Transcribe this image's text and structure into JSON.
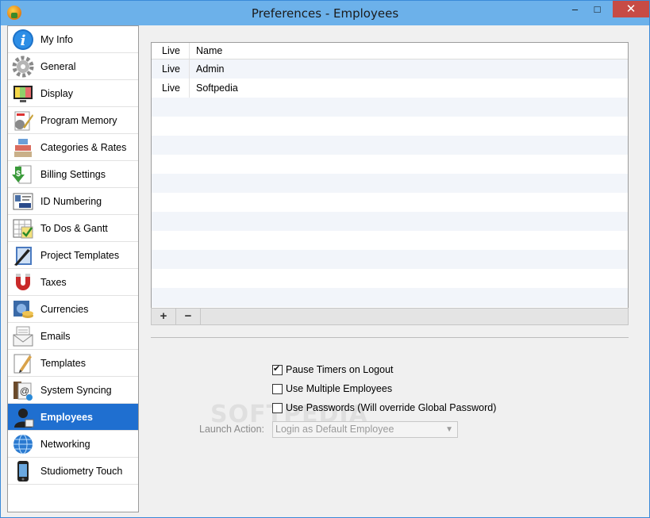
{
  "window": {
    "title": "Preferences - Employees"
  },
  "window_controls": {
    "minimize": "–",
    "maximize": "□",
    "close": "✕"
  },
  "sidebar": {
    "items": [
      {
        "label": "My Info",
        "icon": "info-icon"
      },
      {
        "label": "General",
        "icon": "gear-icon"
      },
      {
        "label": "Display",
        "icon": "monitor-icon"
      },
      {
        "label": "Program Memory",
        "icon": "memory-icon"
      },
      {
        "label": "Categories & Rates",
        "icon": "categories-icon"
      },
      {
        "label": "Billing Settings",
        "icon": "billing-icon"
      },
      {
        "label": "ID Numbering",
        "icon": "id-card-icon"
      },
      {
        "label": "To Dos & Gantt",
        "icon": "todo-icon"
      },
      {
        "label": "Project Templates",
        "icon": "project-templates-icon"
      },
      {
        "label": "Taxes",
        "icon": "magnet-icon"
      },
      {
        "label": "Currencies",
        "icon": "currency-icon"
      },
      {
        "label": "Emails",
        "icon": "envelope-icon"
      },
      {
        "label": "Templates",
        "icon": "template-icon"
      },
      {
        "label": "System Syncing",
        "icon": "sync-icon"
      },
      {
        "label": "Employees",
        "icon": "employee-icon"
      },
      {
        "label": "Networking",
        "icon": "globe-icon"
      },
      {
        "label": "Studiometry Touch",
        "icon": "phone-icon"
      }
    ],
    "selected_index": 14
  },
  "employees_table": {
    "columns": [
      "Live",
      "Name"
    ],
    "rows": [
      {
        "live": "Live",
        "name": "Admin"
      },
      {
        "live": "Live",
        "name": "Softpedia"
      }
    ],
    "add_label": "+",
    "remove_label": "−"
  },
  "options": {
    "pause_timers": {
      "label": "Pause Timers on Logout",
      "checked": true
    },
    "multiple_employees": {
      "label": "Use Multiple Employees",
      "checked": false
    },
    "use_passwords": {
      "label": "Use Passwords (Will override Global Password)",
      "checked": false
    }
  },
  "launch_action": {
    "label": "Launch Action:",
    "value": "Login as Default Employee"
  },
  "watermark": "SOFTPEDIA",
  "colors": {
    "selected": "#1f6fd0",
    "titlebar": "#6cb1ea",
    "close": "#c74b45"
  }
}
